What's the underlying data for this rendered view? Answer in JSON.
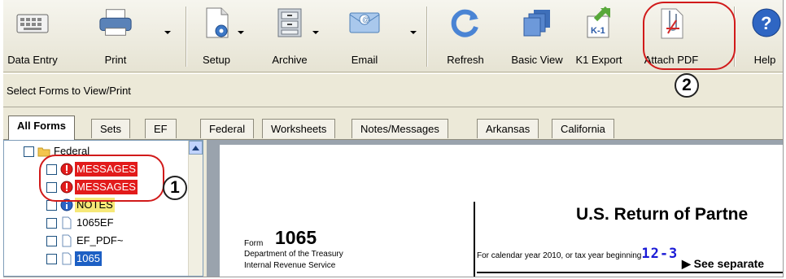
{
  "toolbar": {
    "data_entry": "Data Entry",
    "print": "Print",
    "setup": "Setup",
    "archive": "Archive",
    "email": "Email",
    "refresh": "Refresh",
    "basic_view": "Basic View",
    "k1_export": "K1 Export",
    "k1_icon_text": "K-1",
    "attach_pdf": "Attach PDF",
    "help": "Help"
  },
  "select_bar": {
    "label": "Select Forms to View/Print"
  },
  "tabs": [
    "All Forms",
    "Sets",
    "EF",
    "Federal",
    "Worksheets",
    "Notes/Messages",
    "Arkansas",
    "California"
  ],
  "tree": {
    "root": "Federal",
    "items": [
      "MESSAGES",
      "MESSAGES",
      "NOTES",
      "1065EF",
      "EF_PDF~",
      "1065"
    ]
  },
  "form": {
    "form_label": "Form",
    "form_number": "1065",
    "dept_line1": "Department of the Treasury",
    "dept_line2": "Internal Revenue Service",
    "title": "U.S. Return of Partne",
    "calendar_text": "For calendar year 2010, or tax year beginning",
    "year_value": "12-3",
    "see_separate": "See separate"
  },
  "callouts": {
    "one": "1",
    "two": "2"
  },
  "colors": {
    "message_red": "#e21b1b",
    "notes_yellow": "#f6e878",
    "selected_blue": "#1c5fc4",
    "callout_red": "#d11a1a"
  }
}
